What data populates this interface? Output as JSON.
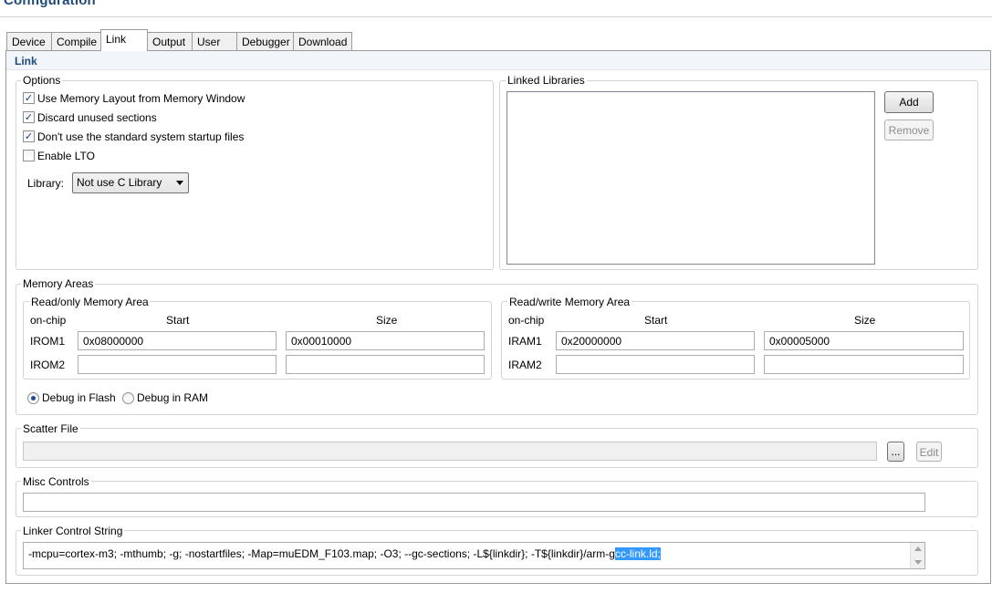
{
  "window": {
    "title": "Configuration"
  },
  "tabs": [
    {
      "label": "Device",
      "active": false
    },
    {
      "label": "Compile",
      "active": false
    },
    {
      "label": "Link",
      "active": true
    },
    {
      "label": "Output",
      "active": false
    },
    {
      "label": "User",
      "active": false
    },
    {
      "label": "Debugger",
      "active": false
    },
    {
      "label": "Download",
      "active": false
    }
  ],
  "section": {
    "title": "Link"
  },
  "options": {
    "title": "Options",
    "checkboxes": [
      {
        "label": "Use Memory Layout from Memory Window",
        "checked": true
      },
      {
        "label": "Discard unused sections",
        "checked": true
      },
      {
        "label": "Don't use the standard system startup files",
        "checked": true
      },
      {
        "label": "Enable LTO",
        "checked": false
      }
    ],
    "library_label": "Library:",
    "library_value": "Not use C Library"
  },
  "linked_libraries": {
    "title": "Linked Libraries",
    "items": [],
    "add_label": "Add",
    "remove_label": "Remove"
  },
  "memory_areas": {
    "title": "Memory Areas",
    "readonly": {
      "title": "Read/only Memory Area",
      "col_onchip": "on-chip",
      "col_start": "Start",
      "col_size": "Size",
      "rows": [
        {
          "name": "IROM1",
          "start": "0x08000000",
          "size": "0x00010000"
        },
        {
          "name": "IROM2",
          "start": "",
          "size": ""
        }
      ]
    },
    "readwrite": {
      "title": "Read/write Memory Area",
      "col_onchip": "on-chip",
      "col_start": "Start",
      "col_size": "Size",
      "rows": [
        {
          "name": "IRAM1",
          "start": "0x20000000",
          "size": "0x00005000"
        },
        {
          "name": "IRAM2",
          "start": "",
          "size": ""
        }
      ]
    },
    "debug_flash_label": "Debug in Flash",
    "debug_ram_label": "Debug in RAM",
    "debug_mode": "flash"
  },
  "scatter_file": {
    "title": "Scatter File",
    "value": "",
    "browse_label": "...",
    "edit_label": "Edit"
  },
  "misc_controls": {
    "title": "Misc Controls",
    "value": ""
  },
  "linker_control": {
    "title": "Linker Control String",
    "text_plain": "-mcpu=cortex-m3; -mthumb; -g; -nostartfiles; -Map=muEDM_F103.map; -O3; --gc-sections; -L${linkdir}; -T${linkdir}/arm-g",
    "text_selected": "cc-link.ld;"
  },
  "colors": {
    "accent": "#1e4a7a",
    "selection": "#3399ff",
    "radio_dot": "#1f4f8a"
  }
}
